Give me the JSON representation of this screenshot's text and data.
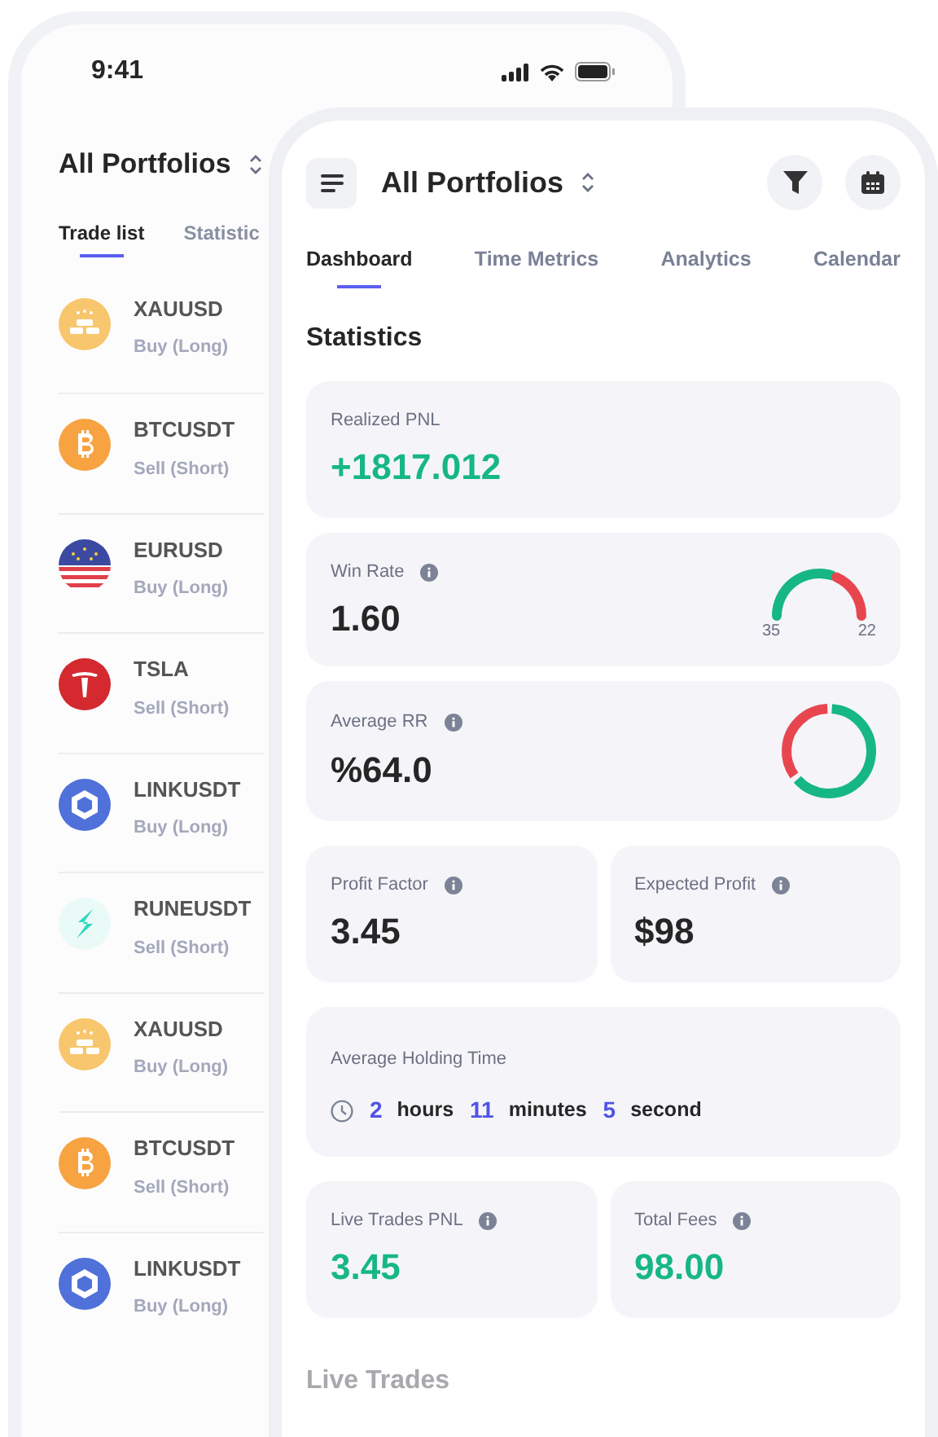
{
  "left_phone": {
    "status_bar": {
      "time": "9:41"
    },
    "title": "All Portfolios",
    "tabs": [
      {
        "label": "Trade list",
        "selected": true
      },
      {
        "label": "Statistic",
        "selected": false
      }
    ],
    "trades": [
      {
        "symbol": "XAUUSD",
        "side": "Buy (Long)",
        "kind": "gold"
      },
      {
        "symbol": "BTCUSDT",
        "side": "Sell (Short)",
        "kind": "bitcoin"
      },
      {
        "symbol": "EURUSD",
        "side": "Buy (Long)",
        "kind": "flag"
      },
      {
        "symbol": "TSLA",
        "side": "Sell (Short)",
        "kind": "tesla"
      },
      {
        "symbol": "LINKUSDT",
        "side": "Buy (Long)",
        "kind": "chainlink"
      },
      {
        "symbol": "RUNEUSDT",
        "side": "Sell (Short)",
        "kind": "rune"
      },
      {
        "symbol": "XAUUSD",
        "side": "Buy (Long)",
        "kind": "gold"
      },
      {
        "symbol": "BTCUSDT",
        "side": "Sell (Short)",
        "kind": "bitcoin"
      },
      {
        "symbol": "LINKUSDT",
        "side": "Buy (Long)",
        "kind": "chainlink"
      }
    ]
  },
  "right_phone": {
    "title": "All Portfolios",
    "tabs": [
      {
        "label": "Dashboard",
        "selected": true
      },
      {
        "label": "Time Metrics",
        "selected": false
      },
      {
        "label": "Analytics",
        "selected": false
      },
      {
        "label": "Calendar",
        "selected": false
      }
    ],
    "section_title": "Statistics",
    "realized": {
      "label": "Realized PNL",
      "value": "+1817.012",
      "positive": true
    },
    "win_rate": {
      "label": "Win Rate",
      "value": "1.60",
      "wins": "35",
      "losses": "22"
    },
    "average_rr": {
      "label": "Average RR",
      "value": "%64.0"
    },
    "metrics_1": [
      {
        "label": "Profit Factor",
        "value": "3.45",
        "positive": false
      },
      {
        "label": "Expected Profit",
        "value": "$98",
        "positive": false
      }
    ],
    "holding": {
      "label": "Average Holding Time",
      "parts": [
        {
          "number": "2",
          "unit": "hours"
        },
        {
          "number": "11",
          "unit": "minutes"
        },
        {
          "number": "5",
          "unit": "second"
        }
      ]
    },
    "metrics_2": [
      {
        "label": "Live Trades PNL",
        "value": "3.45",
        "positive": true
      },
      {
        "label": "Total Fees",
        "value": "98.00",
        "positive": true
      }
    ],
    "live_section_title": "Live Trades"
  }
}
